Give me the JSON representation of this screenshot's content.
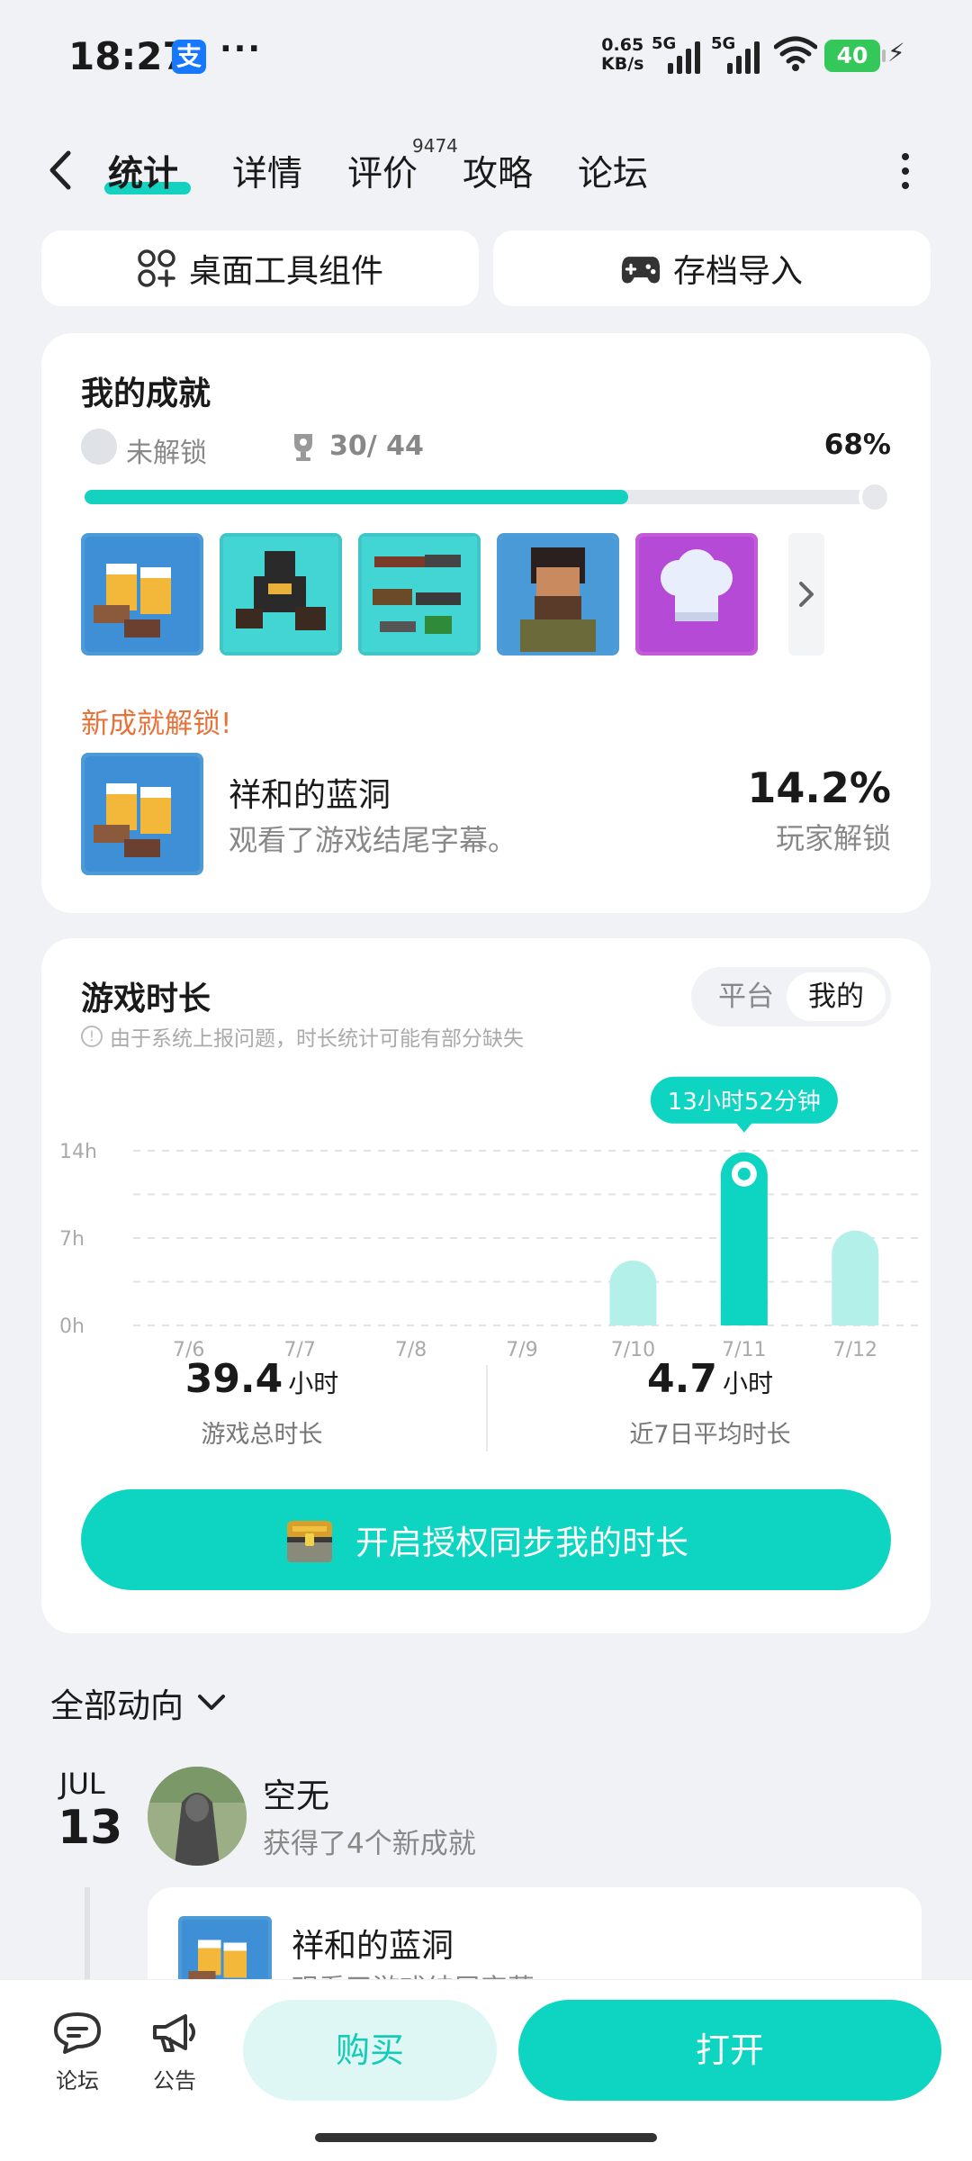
{
  "status_bar": {
    "time": "18:27",
    "app_badge": "支",
    "more": "···",
    "net_speed_value": "0.65",
    "net_speed_unit": "KB/s",
    "sim1": "5G",
    "sim2": "5G",
    "battery": "40"
  },
  "tabs": {
    "items": [
      "统计",
      "详情",
      "评价",
      "攻略",
      "论坛"
    ],
    "review_count": "9474"
  },
  "quick_buttons": {
    "widget": "桌面工具组件",
    "import": "存档导入"
  },
  "achievements": {
    "title": "我的成就",
    "locked_label": "未解锁",
    "count": "30/ 44",
    "percent": "68%",
    "progress_fraction": 0.68,
    "new_unlock_label": "新成就解锁!",
    "new_name": "祥和的蓝洞",
    "new_desc": "观看了游戏结尾字幕。",
    "new_pct": "14.2%",
    "new_pct_label": "玩家解锁",
    "badges": [
      "beer-toast",
      "dark-crawler",
      "weapons",
      "bearded-man",
      "chef-hat"
    ]
  },
  "play_time": {
    "title": "游戏时长",
    "note": "由于系统上报问题，时长统计可能有部分缺失",
    "toggle_platform": "平台",
    "toggle_mine": "我的",
    "highlight_label": "13小时52分钟",
    "total_value": "39.4",
    "total_unit": "小时",
    "total_label": "游戏总时长",
    "avg_value": "4.7",
    "avg_unit": "小时",
    "avg_label": "近7日平均时长",
    "sync_button": "开启授权同步我的时长",
    "colors": {
      "accent": "#0dd5c1",
      "bar_light": "#b3f0ea"
    }
  },
  "chart_data": {
    "type": "bar",
    "categories": [
      "7/6",
      "7/7",
      "7/8",
      "7/9",
      "7/10",
      "7/11",
      "7/12"
    ],
    "values": [
      0,
      0,
      0,
      0,
      5.2,
      13.87,
      7.6
    ],
    "highlight_index": 5,
    "yticks": [
      "14h",
      "7h",
      "0h"
    ],
    "ytick_values": [
      14,
      7,
      0
    ],
    "ylim": [
      0,
      14
    ],
    "grid": true
  },
  "activity": {
    "filter_label": "全部动向",
    "date_month": "JUL",
    "date_day": "13",
    "user_name": "空无",
    "user_desc": "获得了4个新成就",
    "item_name": "祥和的蓝洞",
    "item_desc": "观看了游戏结尾字幕"
  },
  "bottom_bar": {
    "forum": "论坛",
    "notice": "公告",
    "buy": "购买",
    "open": "打开"
  }
}
